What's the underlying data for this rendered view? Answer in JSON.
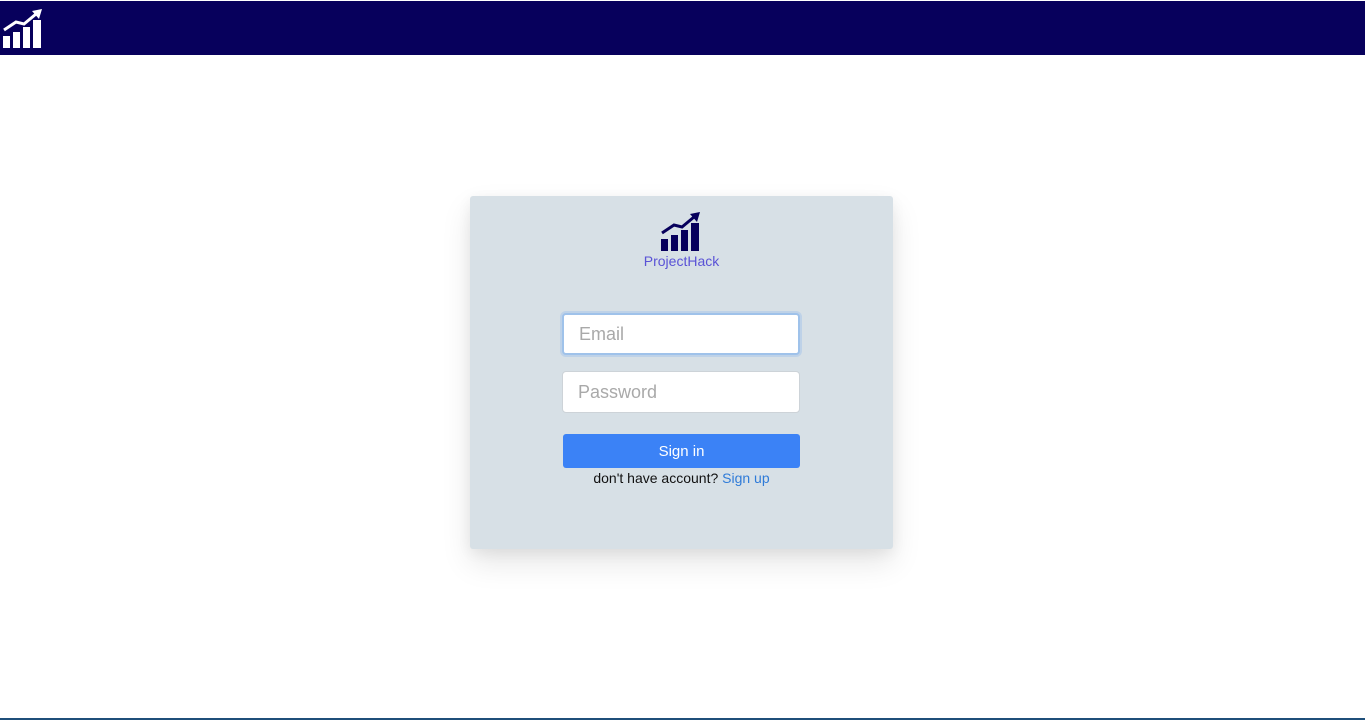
{
  "header": {
    "logo_icon": "chart-growth-icon",
    "logo_color": "#ffffff",
    "background": "#07005c"
  },
  "login": {
    "logo_icon": "chart-growth-icon",
    "logo_color": "#07005c",
    "brand_name": "ProjectHack",
    "email": {
      "value": "",
      "placeholder": "Email"
    },
    "password": {
      "value": "",
      "placeholder": "Password"
    },
    "submit_label": "Sign in",
    "signup_prompt": "don't have account?",
    "signup_link": "Sign up",
    "accent_color": "#3b82f6"
  }
}
